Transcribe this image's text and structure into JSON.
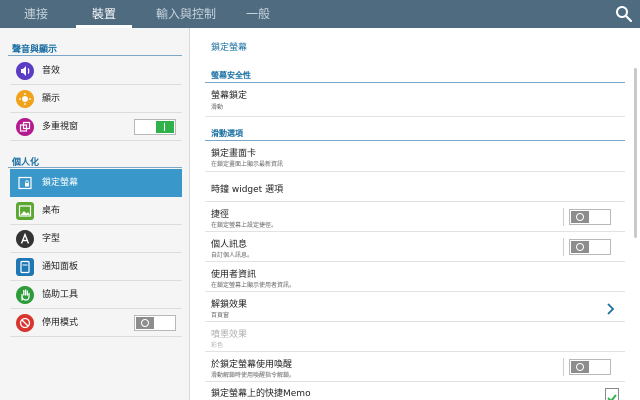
{
  "tabs": [
    {
      "label": "連接"
    },
    {
      "label": "裝置"
    },
    {
      "label": "輸入與控制"
    },
    {
      "label": "一般"
    }
  ],
  "colors": {
    "header": "#4e6b80",
    "accent": "#3a97c9",
    "toggle_on": "#2fb24a"
  },
  "sidebar": {
    "sections": [
      {
        "title": "聲音與顯示"
      },
      {
        "title": "個人化"
      }
    ],
    "items": [
      {
        "label": "音效",
        "icon": "speaker-icon"
      },
      {
        "label": "顯示",
        "icon": "brightness-icon"
      },
      {
        "label": "多重視窗",
        "icon": "multi-window-icon",
        "toggle": "on"
      },
      {
        "label": "鎖定螢幕",
        "icon": "lock-screen-icon",
        "selected": true
      },
      {
        "label": "桌布",
        "icon": "wallpaper-icon"
      },
      {
        "label": "字型",
        "icon": "font-icon"
      },
      {
        "label": "通知面板",
        "icon": "notification-panel-icon"
      },
      {
        "label": "協助工具",
        "icon": "hand-icon"
      },
      {
        "label": "停用模式",
        "icon": "blocking-mode-icon",
        "toggle": "off"
      }
    ]
  },
  "main": {
    "title": "鎖定螢幕",
    "sections": [
      {
        "title": "螢幕安全性"
      },
      {
        "title": "滑動選項"
      }
    ],
    "rows": [
      {
        "title": "螢幕鎖定",
        "sub": "滑動"
      },
      {
        "title": "鎖定畫面卡",
        "sub": "在鎖定畫面上顯示最新資訊"
      },
      {
        "title": "時鐘 widget 選項",
        "sub": ""
      },
      {
        "title": "捷徑",
        "sub": "在鎖定螢幕上設定捷徑。",
        "toggle": "off"
      },
      {
        "title": "個人訊息",
        "sub": "自訂個人訊息。",
        "toggle": "off"
      },
      {
        "title": "使用者資訊",
        "sub": "在鎖定螢幕上顯示使用者資訊。"
      },
      {
        "title": "解鎖效果",
        "sub": "百頁窗"
      },
      {
        "title": "噴墨效果",
        "sub": "彩色",
        "disabled": true
      },
      {
        "title": "於鎖定螢幕使用喚醒",
        "sub": "滑動解鎖時使用喚醒指令解鎖。",
        "toggle": "off"
      },
      {
        "title": "鎖定螢幕上的快捷Memo",
        "sub": "",
        "checked": true
      }
    ]
  }
}
